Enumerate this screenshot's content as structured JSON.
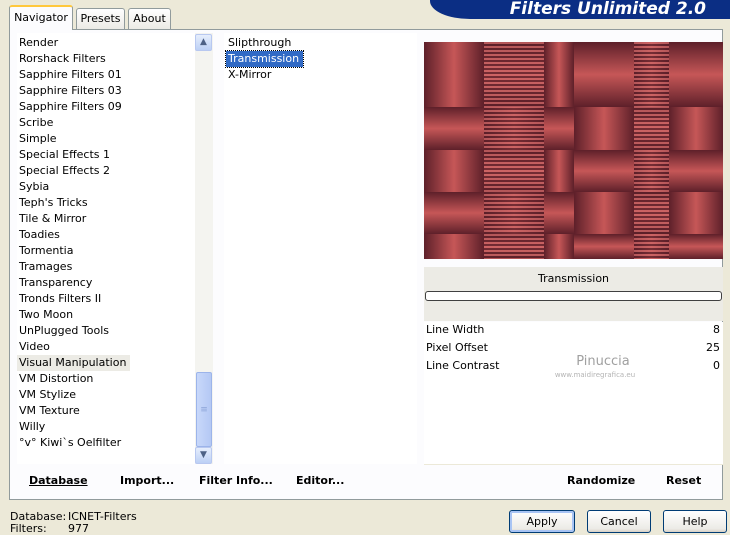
{
  "tabs": [
    {
      "label": "Navigator",
      "active": true
    },
    {
      "label": "Presets",
      "active": false
    },
    {
      "label": "About",
      "active": false
    }
  ],
  "logo": "Filters Unlimited 2.0",
  "categories": [
    "Render",
    "Rorshack Filters",
    "Sapphire Filters 01",
    "Sapphire Filters 03",
    "Sapphire Filters 09",
    "Scribe",
    "Simple",
    "Special Effects 1",
    "Special Effects 2",
    "Sybia",
    "Teph's Tricks",
    "Tile & Mirror",
    "Toadies",
    "Tormentia",
    "Tramages",
    "Transparency",
    "Tronds Filters II",
    "Two Moon",
    "UnPlugged Tools",
    "Video",
    "Visual Manipulation",
    "VM Distortion",
    "VM Stylize",
    "VM Texture",
    "Willy",
    "°v° Kiwi`s Oelfilter"
  ],
  "selected_category": "Visual Manipulation",
  "filters": [
    "Slipthrough",
    "Transmission",
    "X-Mirror"
  ],
  "selected_filter": "Transmission",
  "preview": {
    "filter_name": "Transmission",
    "colors": {
      "light": "#c85858",
      "mid": "#a04048",
      "dark": "#5a1e28",
      "stripe": "#d06868"
    }
  },
  "params": [
    {
      "label": "Line Width",
      "value": "8"
    },
    {
      "label": "Pixel Offset",
      "value": "25"
    },
    {
      "label": "Line Contrast",
      "value": "0"
    }
  ],
  "watermark": {
    "name": "Pinuccia",
    "url": "www.maidiregrafica.eu"
  },
  "bottom_buttons": {
    "database": "Database",
    "import": "Import...",
    "filter_info": "Filter Info...",
    "editor": "Editor...",
    "randomize": "Randomize",
    "reset": "Reset"
  },
  "status": {
    "database_label": "Database:",
    "database_value": "ICNET-Filters",
    "filters_label": "Filters:",
    "filters_value": "977"
  },
  "dialog_buttons": {
    "apply": "Apply",
    "cancel": "Cancel",
    "help": "Help"
  }
}
